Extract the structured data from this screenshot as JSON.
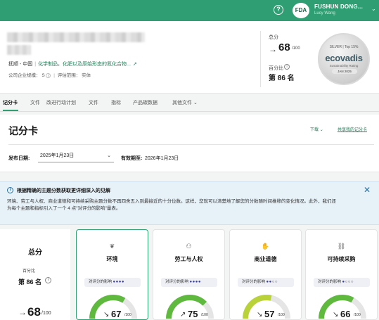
{
  "topbar": {
    "avatar": "FDA",
    "user_name": "FUSHUN DONG...",
    "user_sub": "Lucy Wang",
    "colors": {
      "bar": "#2f9f73"
    }
  },
  "company": {
    "location": "抚顺 - 中国",
    "industry": "化学制品，化肥以及原始形态的氮化合物...",
    "size_label": "公司企业规模：",
    "size_value": "S",
    "scope_label": "评估范围：",
    "scope_value": "实体",
    "score_label": "总分",
    "score_value": "68",
    "score_den": "/100",
    "percentile_label": "百分比",
    "rank": "第 86 名"
  },
  "medal": {
    "line1": "SILVER | Top 15%",
    "brand": "ecovadis",
    "line3": "Sustainability Rating",
    "date": "JAN 2025"
  },
  "tabs": [
    "记分卡",
    "文件",
    "改进行动计划",
    "文件",
    "指标",
    "产品碳数据",
    "其他文件"
  ],
  "scorecard": {
    "title": "记分卡",
    "download": "下载",
    "share": "共享我的记分卡",
    "publish_label": "发布日期:",
    "publish_value": "2025年1月23日",
    "valid_label": "有效期至:",
    "valid_value": "2026年1月23日"
  },
  "info": {
    "heading": "根据精确的主题分数获取更详细深入的见解",
    "body": "环境、劳工与人权、商业道德和可持续采购主题分数不再四舍五入到最接近的十分位数。这样，您就可以清楚地了解您的分数随时间推移的变化情况。此外，我们还为每个主题和指标引入了一个 4 点\"对评分的影响\"量表。"
  },
  "overall": {
    "title": "总分",
    "pct1": "百分比",
    "pct2": "",
    "rank": "第 86 名",
    "value": "68",
    "den": "/100"
  },
  "themes": [
    {
      "name": "环境",
      "icon": "leaf-icon",
      "glyph": "❦",
      "impact_label": "对评分的影响",
      "impact_dots": "●●●●",
      "value": 67,
      "den": "/100"
    },
    {
      "name": "劳工与人权",
      "icon": "people-icon",
      "glyph": "⚇",
      "impact_label": "对评分的影响",
      "impact_dots": "●●●●",
      "value": 75,
      "den": "/100"
    },
    {
      "name": "商业道德",
      "icon": "handshake-icon",
      "glyph": "✋",
      "impact_label": "对评分的影响",
      "impact_dots": "●●○○",
      "value": 57,
      "den": "/100"
    },
    {
      "name": "可持续采购",
      "icon": "link-icon",
      "glyph": "⛓",
      "impact_label": "对评分的影响",
      "impact_dots": "●○○○",
      "value": 66,
      "den": "/100"
    }
  ],
  "gauge_colors": {
    "high": "#5fb93f",
    "mid": "#b9d23a",
    "track": "#e5e5e5"
  }
}
